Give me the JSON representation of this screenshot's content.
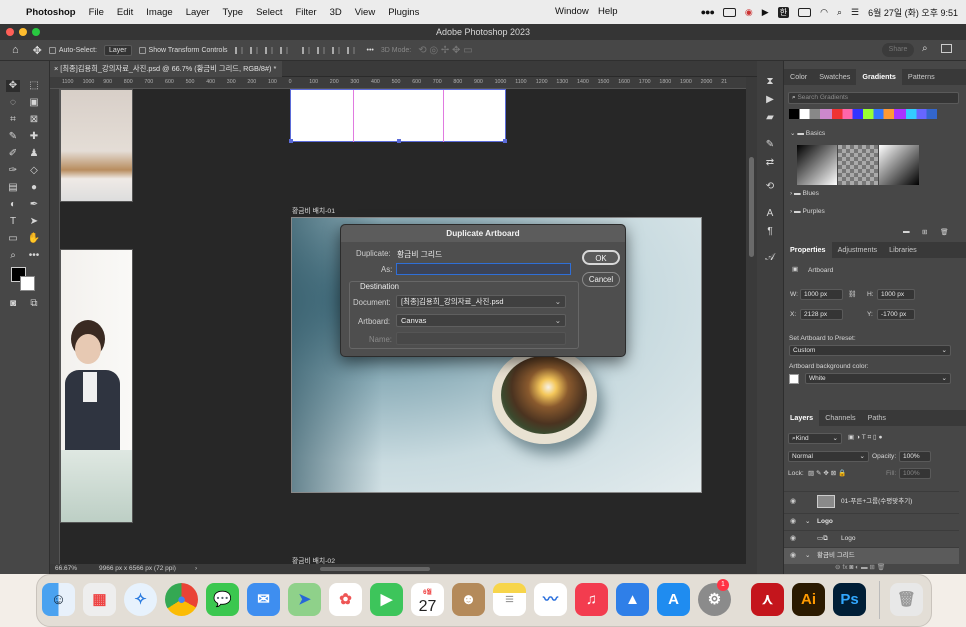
{
  "menubar": {
    "apple": "",
    "app": "Photoshop",
    "items": [
      "File",
      "Edit",
      "Image",
      "Layer",
      "Type",
      "Select",
      "Filter",
      "3D",
      "View",
      "Plugins"
    ],
    "window": "Window",
    "help": "Help",
    "input_badge": "한",
    "datetime": "6월 27일 (화) 오후 9:51"
  },
  "window": {
    "title": "Adobe Photoshop 2023"
  },
  "options": {
    "auto_select": "Auto-Select:",
    "layer": "Layer",
    "show_transform": "Show Transform Controls",
    "mode_3d": "3D Mode:",
    "share": "Share"
  },
  "document": {
    "tab": "[최종]김용희_강의자료_사진.psd @ 66.7% (황금비 그리드, RGB/8#) *",
    "zoom": "66.67%",
    "size": "9966 px x 6566 px (72 ppi)",
    "ruler": [
      "1100",
      "1000",
      "900",
      "800",
      "700",
      "600",
      "500",
      "400",
      "300",
      "200",
      "100",
      "0",
      "100",
      "200",
      "300",
      "400",
      "500",
      "600",
      "700",
      "800",
      "900",
      "1000",
      "1100",
      "1200",
      "1300",
      "1400",
      "1500",
      "1600",
      "1700",
      "1800",
      "1900",
      "2000",
      "21"
    ],
    "artboard1": "황금비 배치-01",
    "artboard2": "황금비 배치-02"
  },
  "dialog": {
    "title": "Duplicate Artboard",
    "duplicate_label": "Duplicate:",
    "duplicate_value": "황금비 그리드",
    "as_label": "As:",
    "as_value": "",
    "destination": "Destination",
    "document_label": "Document:",
    "document_value": "[최종]김용희_강의자료_사진.psd",
    "artboard_label": "Artboard:",
    "artboard_value": "Canvas",
    "name_label": "Name:",
    "ok": "OK",
    "cancel": "Cancel"
  },
  "color_panel": {
    "tabs": [
      "Color",
      "Swatches",
      "Gradients",
      "Patterns"
    ],
    "search_placeholder": "Search Gradients",
    "groups": [
      "Basics",
      "Blues",
      "Purples"
    ]
  },
  "properties": {
    "tabs": [
      "Properties",
      "Adjustments",
      "Libraries"
    ],
    "type": "Artboard",
    "w_label": "W:",
    "w": "1000 px",
    "h_label": "H:",
    "h": "1000 px",
    "x_label": "X:",
    "x": "2128 px",
    "y_label": "Y:",
    "y": "-1700 px",
    "preset_label": "Set Artboard to Preset:",
    "preset": "Custom",
    "bg_label": "Artboard background color:",
    "bg": "White"
  },
  "layers": {
    "tabs": [
      "Layers",
      "Channels",
      "Paths"
    ],
    "kind": "Kind",
    "blend": "Normal",
    "opacity_label": "Opacity:",
    "opacity": "100%",
    "lock_label": "Lock:",
    "fill_label": "Fill:",
    "fill": "100%",
    "items": [
      "01-푸른+그룹(수평맞추기)",
      "Logo",
      "Logo",
      "황금비 그리드"
    ]
  },
  "dock": {
    "calendar_month": "6월",
    "calendar_day": "27",
    "badge": "1"
  }
}
